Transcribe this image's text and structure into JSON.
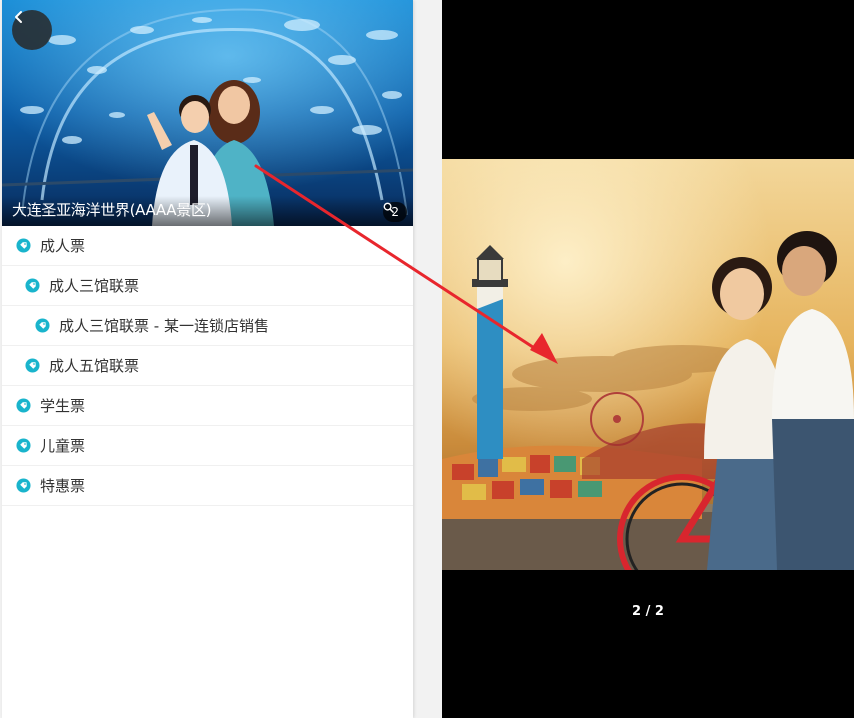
{
  "header": {
    "back_icon": "chevron-left-icon",
    "title": "大连圣亚海洋世界(AAAA景区)",
    "photo_count": "2",
    "photo_count_icon": "search-icon"
  },
  "tickets": [
    {
      "label": "成人票",
      "level": 0
    },
    {
      "label": "成人三馆联票",
      "level": 1
    },
    {
      "label": "成人三馆联票 - 某一连锁店销售",
      "level": 2
    },
    {
      "label": "成人五馆联票",
      "level": 1
    },
    {
      "label": "学生票",
      "level": 0
    },
    {
      "label": "儿童票",
      "level": 0
    },
    {
      "label": "特惠票",
      "level": 0
    }
  ],
  "viewer": {
    "pager": "2 / 2"
  },
  "colors": {
    "tag_icon": "#19b4cc",
    "arrow": "#e8262d",
    "viewer_bg": "#000000"
  }
}
